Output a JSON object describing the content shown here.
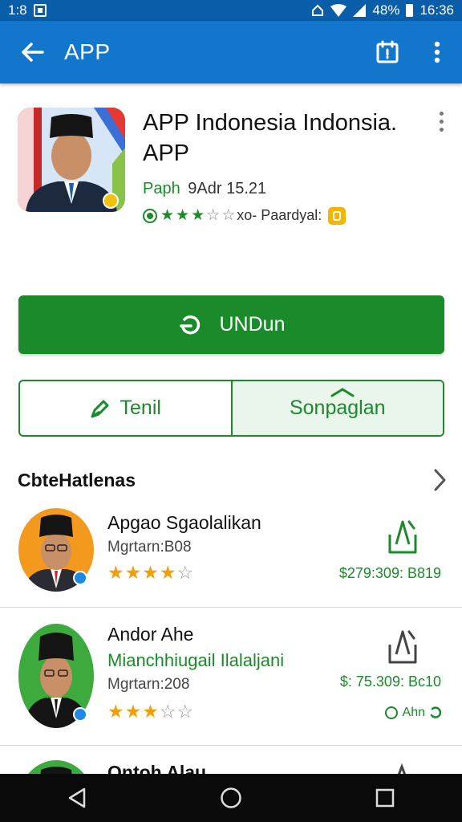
{
  "status_bar": {
    "time_left": "1:8",
    "signal_percent": "48%",
    "time_right": "16:36"
  },
  "app_bar": {
    "title": "APP"
  },
  "app": {
    "title": "APP Indonesia Indonsia. APP",
    "developer": "Paph",
    "date": "9Adr 15.21",
    "rating_text": "xo- Paardyal:",
    "rating_stars": 3.5
  },
  "install_button": {
    "label": "UNDun"
  },
  "secondary_buttons": {
    "left_label": "Tenil",
    "right_label": "Sonpaglan"
  },
  "section": {
    "title": "CbteHatlenas"
  },
  "list": [
    {
      "title": "Apgao Sgaolalikan",
      "subtitle": "",
      "meta": "Mgrtarn:B08",
      "price": "$279:309: B819",
      "stars": 4,
      "extra": "",
      "avatar_bg": "#f39a1e"
    },
    {
      "title": "Andor Ahe",
      "subtitle": "Mianchhiugail Ilalaljani",
      "meta": "Mgrtarn:208",
      "price": "$: 75.309: Bc10",
      "stars": 3,
      "extra": "Ahn",
      "avatar_bg": "#3daa3d"
    },
    {
      "title": "Ontoh Alau",
      "avatar_bg": "#3daa3d"
    }
  ],
  "colors": {
    "status_bar": "#0a5da8",
    "app_bar": "#1277cc",
    "accent_green": "#1b8a2a",
    "star_orange": "#f29d0a"
  },
  "icons": {
    "back": "arrow-left-icon",
    "app_bar_action": "calendar-icon",
    "more": "more-vert-icon",
    "install": "refresh-icon",
    "outline_left": "pencil-icon",
    "share": "share-icon",
    "chevron": "chevron-right-icon",
    "nav_back": "triangle-back-icon",
    "nav_home": "circle-home-icon",
    "nav_recent": "square-recent-icon"
  }
}
